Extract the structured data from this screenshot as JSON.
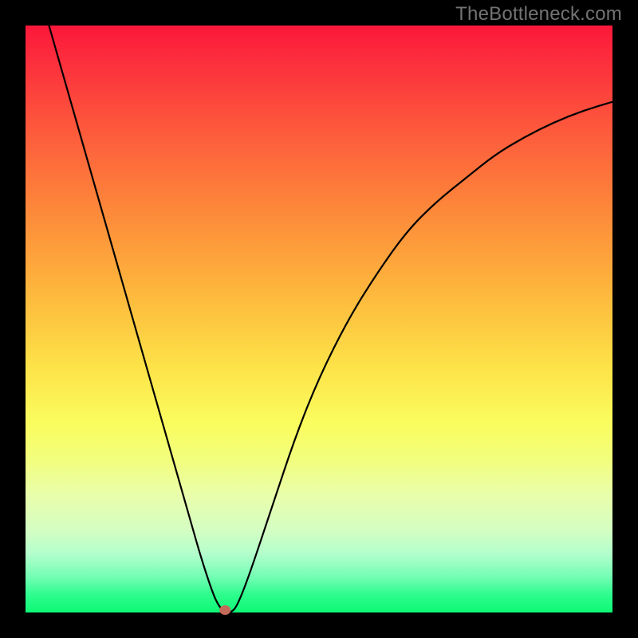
{
  "watermark": "TheBottleneck.com",
  "colors": {
    "frame": "#000000",
    "gradient_top": "#fb173a",
    "gradient_bottom": "#0ef977",
    "curve": "#000000",
    "min_marker": "#c46a5a"
  },
  "chart_data": {
    "type": "line",
    "title": "",
    "xlabel": "",
    "ylabel": "",
    "xlim": [
      0,
      100
    ],
    "ylim": [
      0,
      100
    ],
    "x": [
      4,
      8,
      12,
      16,
      20,
      24,
      28,
      30,
      32,
      33,
      34,
      35,
      36,
      38,
      42,
      46,
      50,
      55,
      60,
      65,
      70,
      75,
      80,
      85,
      90,
      95,
      100
    ],
    "values": [
      100,
      86,
      72,
      58,
      44,
      30,
      16,
      9,
      3,
      1,
      0,
      0,
      1,
      6,
      18,
      30,
      40,
      50,
      58,
      65,
      70,
      74,
      78,
      81,
      83.5,
      85.5,
      87
    ],
    "min_point": {
      "x": 34,
      "y": 0
    },
    "annotations": []
  }
}
